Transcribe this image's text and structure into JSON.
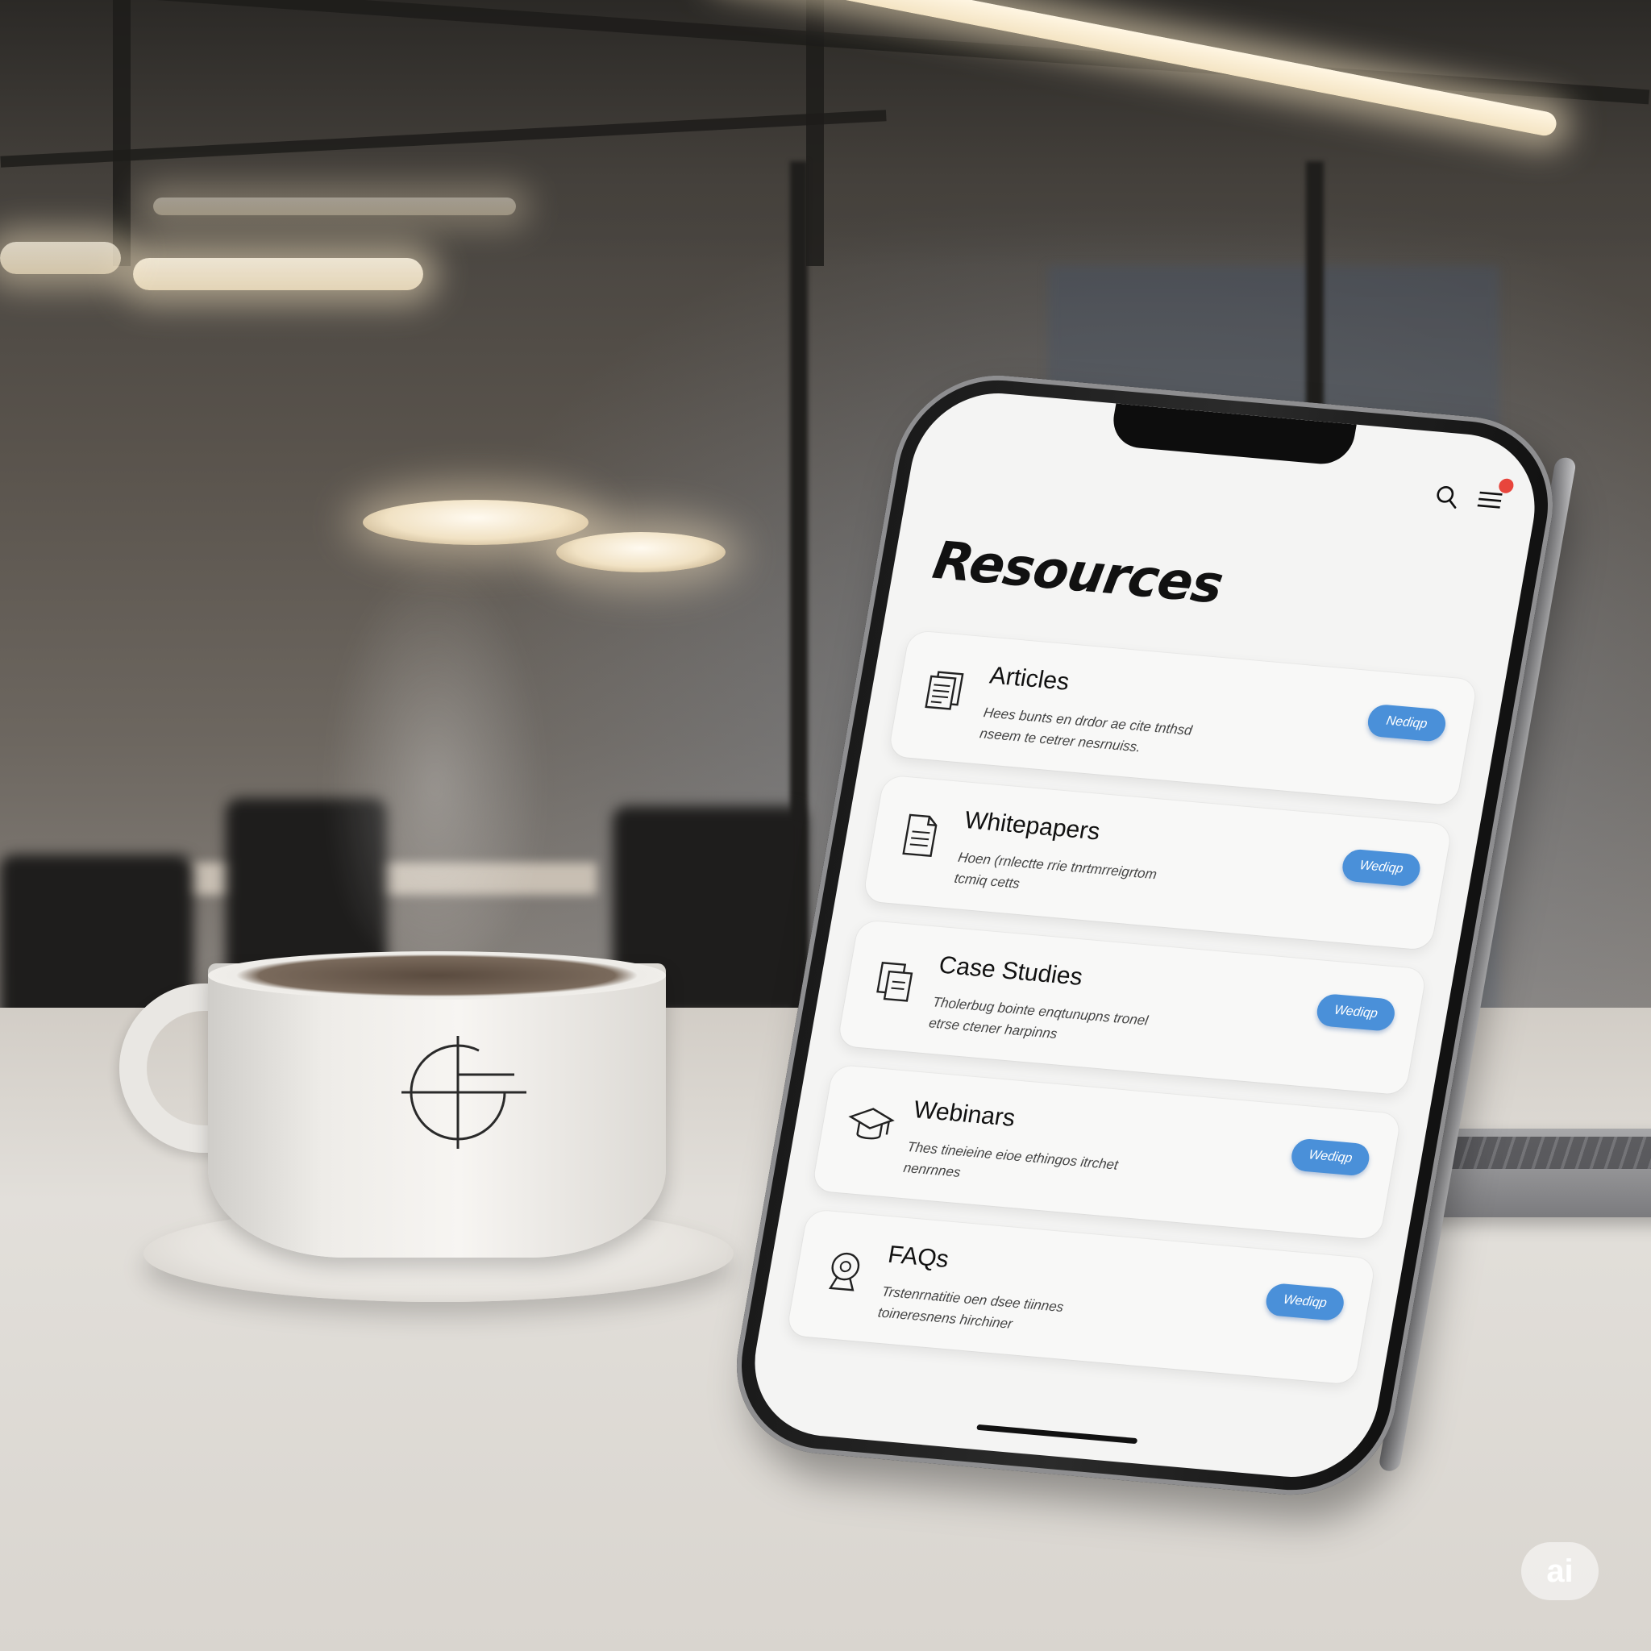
{
  "app": {
    "title": "Resources",
    "icons": [
      "search-icon",
      "menu-icon"
    ],
    "notification_color": "#e8453c",
    "accent_color": "#4a90d9"
  },
  "cards": [
    {
      "title": "Articles",
      "icon": "document-stack-icon",
      "description": "Hees bunts en drdor ae cite tnthsd nseem te cetrer nesrnuiss.",
      "button": "Nediqp"
    },
    {
      "title": "Whitepapers",
      "icon": "document-icon",
      "description": "Hoen (rnlectte rrie tnrtmrreigrtom tcmiq cetts",
      "button": "Wediqp"
    },
    {
      "title": "Case Studies",
      "icon": "folder-files-icon",
      "description": "Tholerbug bointe enqtunupns tronel etrse ctener harpinns",
      "button": "Wediqp"
    },
    {
      "title": "Webinars",
      "icon": "graduation-cap-icon",
      "description": "Thes tineieine eioe ethingos itrchet nenrnnes",
      "button": "Wediqp"
    },
    {
      "title": "FAQs",
      "icon": "help-bubble-icon",
      "description": "Trstenrnatitie oen dsee tiinnes toineresnens hirchiner",
      "button": "Wediqp"
    }
  ],
  "mug": {
    "logo": "crosshair-logo"
  },
  "watermark": "ai"
}
